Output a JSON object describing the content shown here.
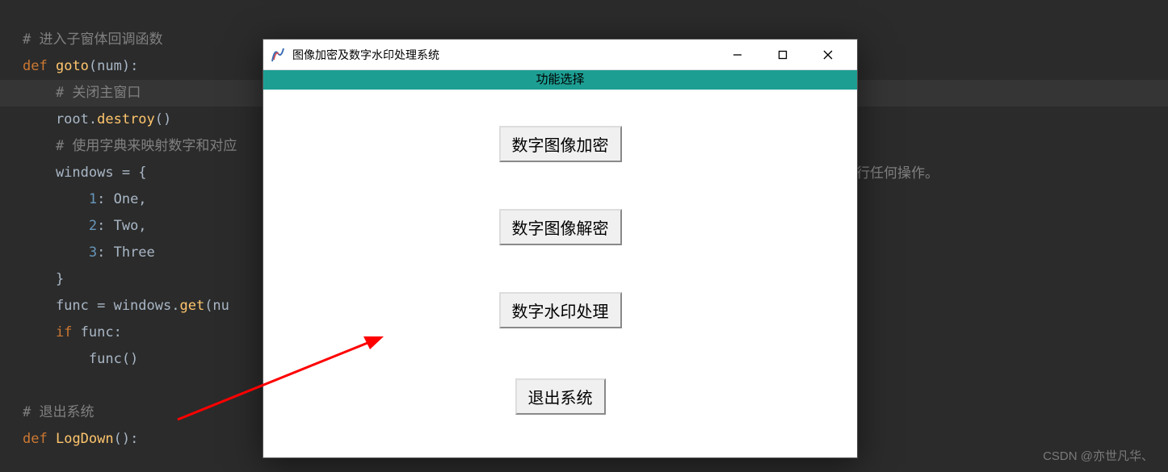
{
  "code": {
    "line0": "",
    "line1": "# 进入子窗体回调函数",
    "line2_def": "def",
    "line2_name": "goto",
    "line2_params": "(num):",
    "line3": "    # 关闭主窗口",
    "line4_a": "    root.",
    "line4_b": "destroy",
    "line4_c": "()",
    "line5": "    # 使用字典来映射数字和对应",
    "line6": "    windows = {",
    "line7_k": "        1",
    "line7_v": ": One,",
    "line8_k": "        2",
    "line8_v": ": Two,",
    "line9_k": "        3",
    "line9_v": ": Three",
    "line10": "    }",
    "line11_a": "    func = windows.",
    "line11_b": "get",
    "line11_c": "(nu",
    "line12_if": "    if",
    "line12_rest": " func:",
    "line13": "        func()",
    "line14": "",
    "line15": "# 退出系统",
    "line16_def": "def",
    "line16_name": "LogDown",
    "line16_rest": "():",
    "partial_right": "行任何操作。"
  },
  "window": {
    "title": "图像加密及数字水印处理系统",
    "banner": "功能选择",
    "buttons": {
      "encrypt": "数字图像加密",
      "decrypt": "数字图像解密",
      "watermark": "数字水印处理",
      "exit": "退出系统"
    }
  },
  "watermark": "CSDN @亦世凡华、"
}
